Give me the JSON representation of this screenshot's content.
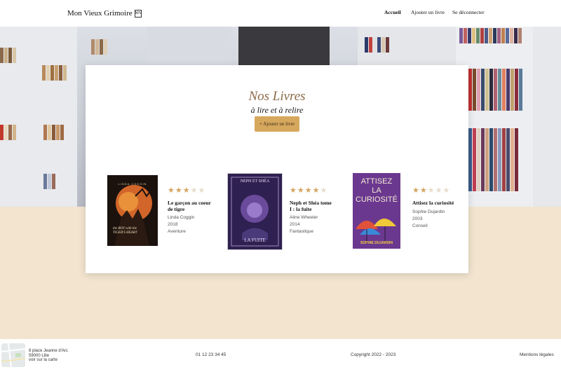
{
  "header": {
    "logo_text": "Mon Vieux Grimoire",
    "logo_mark": "MV",
    "nav": {
      "home": "Accueil",
      "add_book": "Ajouter un livre",
      "logout": "Se déconnecter"
    }
  },
  "main": {
    "title": "Nos Livres",
    "subtitle": "à lire et à relire",
    "add_button": "+ Ajouter un livre"
  },
  "books": [
    {
      "title": "Le garçon au coeur de tigre",
      "author": "Linda Coggin",
      "year": "2018",
      "genre": "Aventure",
      "rating": 3,
      "max_rating": 5,
      "cover_text_top": "LINDA COGGIN",
      "cover_text_bottom": "the BOY with the TIGER'S HEART"
    },
    {
      "title": "Neph et Shéa tome I : la fuite",
      "author": "Aline Wheeler",
      "year": "2014",
      "genre": "Fantastique",
      "rating": 4,
      "max_rating": 5,
      "cover_text_top": "NEPH ET SHÉA",
      "cover_text_bottom": "LA FUITE"
    },
    {
      "title": "Attisez la curiosité",
      "author": "Sophie Dujardin",
      "year": "2003",
      "genre": "Conseil",
      "rating": 2,
      "max_rating": 5,
      "cover_text_top": "ATTISEZ LA CURIOSITÉ",
      "cover_text_bottom": "SOPHIE DUJARDIN"
    }
  ],
  "footer": {
    "address_line1": "8 place Jeanne d'Arc",
    "address_line2": "59000 Lille",
    "map_link": "voir sur la carte",
    "phone": "01 12 23 34 45",
    "copyright": "Copyright 2022 - 2023",
    "legal": "Mentions légales"
  },
  "colors": {
    "accent": "#d6a85e",
    "title": "#8a6a48",
    "star_on": "#d4a45e",
    "star_off": "#e8dccb",
    "page_bg": "#f2e4cf"
  }
}
